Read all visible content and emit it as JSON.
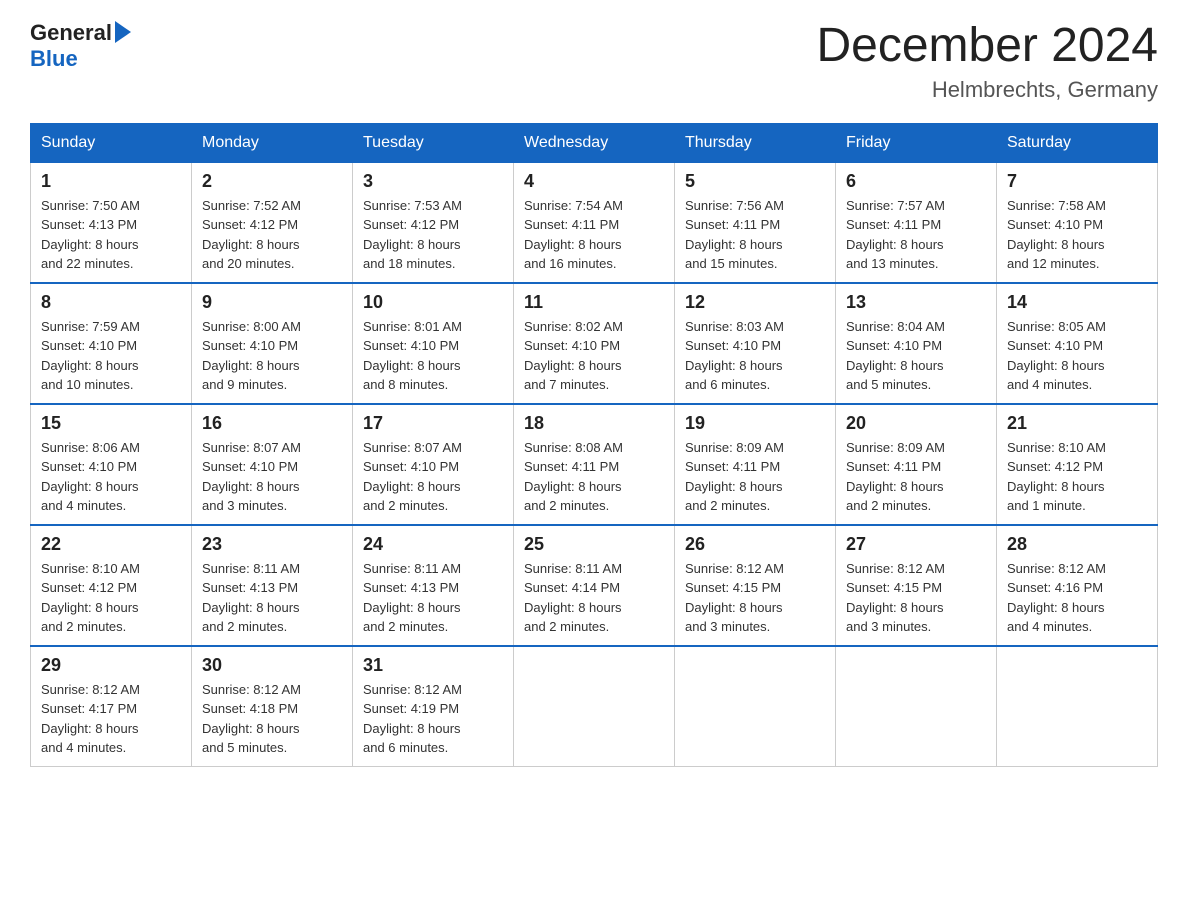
{
  "header": {
    "logo_general": "General",
    "logo_blue": "Blue",
    "title": "December 2024",
    "location": "Helmbrechts, Germany"
  },
  "days_of_week": [
    "Sunday",
    "Monday",
    "Tuesday",
    "Wednesday",
    "Thursday",
    "Friday",
    "Saturday"
  ],
  "weeks": [
    [
      {
        "day": "1",
        "sunrise": "7:50 AM",
        "sunset": "4:13 PM",
        "daylight": "8 hours and 22 minutes."
      },
      {
        "day": "2",
        "sunrise": "7:52 AM",
        "sunset": "4:12 PM",
        "daylight": "8 hours and 20 minutes."
      },
      {
        "day": "3",
        "sunrise": "7:53 AM",
        "sunset": "4:12 PM",
        "daylight": "8 hours and 18 minutes."
      },
      {
        "day": "4",
        "sunrise": "7:54 AM",
        "sunset": "4:11 PM",
        "daylight": "8 hours and 16 minutes."
      },
      {
        "day": "5",
        "sunrise": "7:56 AM",
        "sunset": "4:11 PM",
        "daylight": "8 hours and 15 minutes."
      },
      {
        "day": "6",
        "sunrise": "7:57 AM",
        "sunset": "4:11 PM",
        "daylight": "8 hours and 13 minutes."
      },
      {
        "day": "7",
        "sunrise": "7:58 AM",
        "sunset": "4:10 PM",
        "daylight": "8 hours and 12 minutes."
      }
    ],
    [
      {
        "day": "8",
        "sunrise": "7:59 AM",
        "sunset": "4:10 PM",
        "daylight": "8 hours and 10 minutes."
      },
      {
        "day": "9",
        "sunrise": "8:00 AM",
        "sunset": "4:10 PM",
        "daylight": "8 hours and 9 minutes."
      },
      {
        "day": "10",
        "sunrise": "8:01 AM",
        "sunset": "4:10 PM",
        "daylight": "8 hours and 8 minutes."
      },
      {
        "day": "11",
        "sunrise": "8:02 AM",
        "sunset": "4:10 PM",
        "daylight": "8 hours and 7 minutes."
      },
      {
        "day": "12",
        "sunrise": "8:03 AM",
        "sunset": "4:10 PM",
        "daylight": "8 hours and 6 minutes."
      },
      {
        "day": "13",
        "sunrise": "8:04 AM",
        "sunset": "4:10 PM",
        "daylight": "8 hours and 5 minutes."
      },
      {
        "day": "14",
        "sunrise": "8:05 AM",
        "sunset": "4:10 PM",
        "daylight": "8 hours and 4 minutes."
      }
    ],
    [
      {
        "day": "15",
        "sunrise": "8:06 AM",
        "sunset": "4:10 PM",
        "daylight": "8 hours and 4 minutes."
      },
      {
        "day": "16",
        "sunrise": "8:07 AM",
        "sunset": "4:10 PM",
        "daylight": "8 hours and 3 minutes."
      },
      {
        "day": "17",
        "sunrise": "8:07 AM",
        "sunset": "4:10 PM",
        "daylight": "8 hours and 2 minutes."
      },
      {
        "day": "18",
        "sunrise": "8:08 AM",
        "sunset": "4:11 PM",
        "daylight": "8 hours and 2 minutes."
      },
      {
        "day": "19",
        "sunrise": "8:09 AM",
        "sunset": "4:11 PM",
        "daylight": "8 hours and 2 minutes."
      },
      {
        "day": "20",
        "sunrise": "8:09 AM",
        "sunset": "4:11 PM",
        "daylight": "8 hours and 2 minutes."
      },
      {
        "day": "21",
        "sunrise": "8:10 AM",
        "sunset": "4:12 PM",
        "daylight": "8 hours and 1 minute."
      }
    ],
    [
      {
        "day": "22",
        "sunrise": "8:10 AM",
        "sunset": "4:12 PM",
        "daylight": "8 hours and 2 minutes."
      },
      {
        "day": "23",
        "sunrise": "8:11 AM",
        "sunset": "4:13 PM",
        "daylight": "8 hours and 2 minutes."
      },
      {
        "day": "24",
        "sunrise": "8:11 AM",
        "sunset": "4:13 PM",
        "daylight": "8 hours and 2 minutes."
      },
      {
        "day": "25",
        "sunrise": "8:11 AM",
        "sunset": "4:14 PM",
        "daylight": "8 hours and 2 minutes."
      },
      {
        "day": "26",
        "sunrise": "8:12 AM",
        "sunset": "4:15 PM",
        "daylight": "8 hours and 3 minutes."
      },
      {
        "day": "27",
        "sunrise": "8:12 AM",
        "sunset": "4:15 PM",
        "daylight": "8 hours and 3 minutes."
      },
      {
        "day": "28",
        "sunrise": "8:12 AM",
        "sunset": "4:16 PM",
        "daylight": "8 hours and 4 minutes."
      }
    ],
    [
      {
        "day": "29",
        "sunrise": "8:12 AM",
        "sunset": "4:17 PM",
        "daylight": "8 hours and 4 minutes."
      },
      {
        "day": "30",
        "sunrise": "8:12 AM",
        "sunset": "4:18 PM",
        "daylight": "8 hours and 5 minutes."
      },
      {
        "day": "31",
        "sunrise": "8:12 AM",
        "sunset": "4:19 PM",
        "daylight": "8 hours and 6 minutes."
      },
      null,
      null,
      null,
      null
    ]
  ],
  "labels": {
    "sunrise": "Sunrise:",
    "sunset": "Sunset:",
    "daylight": "Daylight:"
  }
}
